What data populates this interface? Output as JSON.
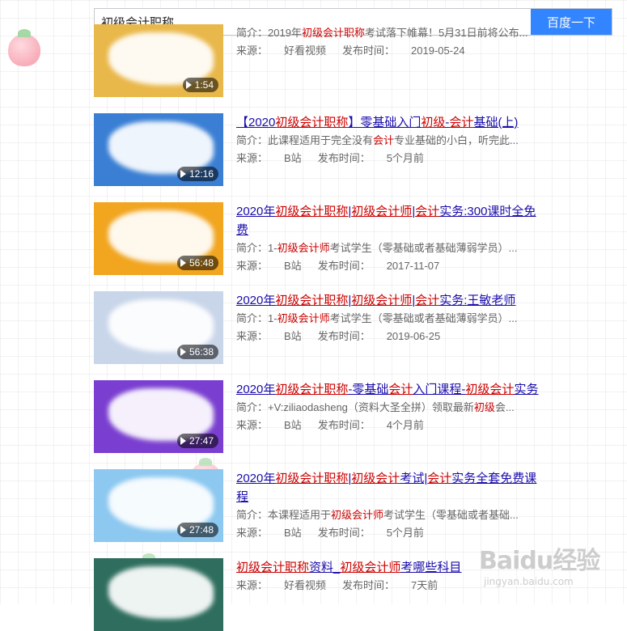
{
  "search": {
    "query": "初级会计职称",
    "button_label": "百度一下"
  },
  "labels": {
    "desc_prefix": "简介：",
    "source_prefix": "来源：",
    "time_prefix": "发布时间："
  },
  "results": [
    {
      "title": [],
      "desc": [
        {
          "t": "2019年"
        },
        {
          "t": "初级会计职称",
          "h": true
        },
        {
          "t": "考试落下帷幕！5月31日前将公布..."
        }
      ],
      "source": "好看视频",
      "time": "2019-05-24",
      "duration": "1:54",
      "thumb_color": "#e9b84a"
    },
    {
      "title": [
        {
          "t": "【2020"
        },
        {
          "t": "初级会计职称",
          "h": true
        },
        {
          "t": "】零基础入门"
        },
        {
          "t": "初级",
          "h": true
        },
        {
          "t": "-"
        },
        {
          "t": "会计",
          "h": true
        },
        {
          "t": "基础(上)"
        }
      ],
      "desc": [
        {
          "t": "此课程适用于完全没有"
        },
        {
          "t": "会计",
          "h": true
        },
        {
          "t": "专业基础的小白，听完此..."
        }
      ],
      "source": "B站",
      "time": "5个月前",
      "duration": "12:16",
      "thumb_color": "#3a7fd4"
    },
    {
      "title": [
        {
          "t": "2020年"
        },
        {
          "t": "初级会计职称",
          "h": true
        },
        {
          "t": "|"
        },
        {
          "t": "初级会计师",
          "h": true
        },
        {
          "t": "|"
        },
        {
          "t": "会计",
          "h": true
        },
        {
          "t": "实务:300课时全免费"
        }
      ],
      "desc": [
        {
          "t": "1-"
        },
        {
          "t": "初级会计师",
          "h": true
        },
        {
          "t": "考试学生（零基础或者基础薄弱学员）..."
        }
      ],
      "source": "B站",
      "time": "2017-11-07",
      "duration": "56:48",
      "thumb_color": "#f2a51f"
    },
    {
      "title": [
        {
          "t": "2020年"
        },
        {
          "t": "初级会计职称",
          "h": true
        },
        {
          "t": "|"
        },
        {
          "t": "初级会计师",
          "h": true
        },
        {
          "t": "|"
        },
        {
          "t": "会计",
          "h": true
        },
        {
          "t": "实务:王敏老师"
        }
      ],
      "desc": [
        {
          "t": "1-"
        },
        {
          "t": "初级会计师",
          "h": true
        },
        {
          "t": "考试学生（零基础或者基础薄弱学员）..."
        }
      ],
      "source": "B站",
      "time": "2019-06-25",
      "duration": "56:38",
      "thumb_color": "#c9d6ea"
    },
    {
      "title": [
        {
          "t": "2020年"
        },
        {
          "t": "初级会计职称",
          "h": true
        },
        {
          "t": "-零基础"
        },
        {
          "t": "会计",
          "h": true
        },
        {
          "t": "入门课程-"
        },
        {
          "t": "初级会",
          "h": true
        },
        {
          "t": "计",
          "h": true
        },
        {
          "t": "实务"
        }
      ],
      "desc": [
        {
          "t": "+V:ziliaodasheng（资料大圣全拼）领取最新"
        },
        {
          "t": "初级",
          "h": true
        },
        {
          "t": "会..."
        }
      ],
      "source": "B站",
      "time": "4个月前",
      "duration": "27:47",
      "thumb_color": "#7a3fd0"
    },
    {
      "title": [
        {
          "t": "2020年"
        },
        {
          "t": "初级会计职称",
          "h": true
        },
        {
          "t": "|"
        },
        {
          "t": "初级会计",
          "h": true
        },
        {
          "t": "考试|"
        },
        {
          "t": "会计",
          "h": true
        },
        {
          "t": "实务全套免费课程"
        }
      ],
      "desc": [
        {
          "t": "本课程适用于"
        },
        {
          "t": "初级会计师",
          "h": true
        },
        {
          "t": "考试学生（零基础或者基础..."
        }
      ],
      "source": "B站",
      "time": "5个月前",
      "duration": "27:48",
      "thumb_color": "#8cc8f0"
    },
    {
      "title": [
        {
          "t": "初级会计职称",
          "h": true
        },
        {
          "t": "资料_"
        },
        {
          "t": "初级会计师",
          "h": true
        },
        {
          "t": "考哪些科目"
        }
      ],
      "desc": [],
      "source": "好看视频",
      "time": "7天前",
      "duration": "",
      "thumb_color": "#2f6e5e"
    }
  ],
  "watermark": {
    "main": "Baidu经验",
    "sub": "jingyan.baidu.com"
  },
  "colors": {
    "accent": "#3385ff",
    "link": "#1a0dab",
    "highlight": "#cc0000"
  }
}
